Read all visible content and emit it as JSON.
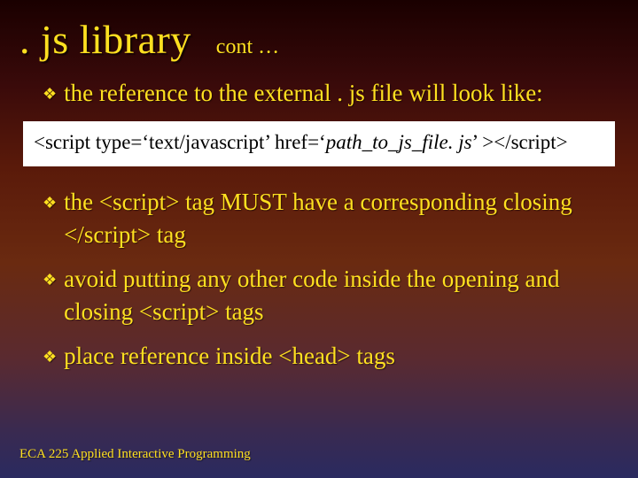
{
  "title": ". js library",
  "subtitle": "cont …",
  "bullets_top": [
    "the reference to the external . js file will look like:"
  ],
  "code": {
    "prefix": "<script type=‘text/javascript’ href=‘",
    "italic": "path_to_js_file. js",
    "suffix": "’ ></script>"
  },
  "bullets_bottom": [
    "the <script> tag MUST have a corresponding closing </script> tag",
    "avoid putting any other code inside the opening and closing <script> tags",
    "place reference inside <head> tags"
  ],
  "footer": "ECA 225   Applied Interactive Programming"
}
